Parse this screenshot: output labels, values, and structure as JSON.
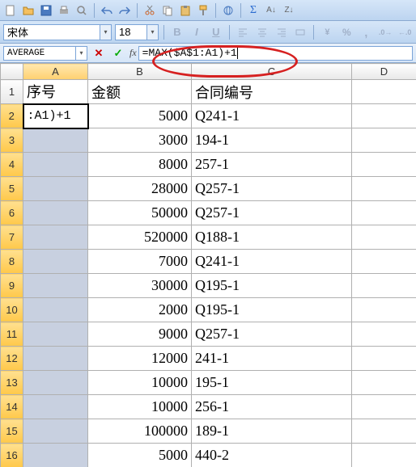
{
  "toolbar": {
    "icons_row1": [
      "new",
      "open",
      "save",
      "print",
      "preview",
      "sep",
      "undo",
      "redo",
      "sep",
      "cut",
      "copy",
      "paste",
      "format-painter",
      "sep",
      "hyperlink",
      "sep",
      "sum",
      "sort-asc",
      "sort-desc"
    ]
  },
  "font": {
    "name": "宋体",
    "size": "18"
  },
  "format_buttons": [
    "B",
    "I",
    "U",
    "sep",
    "align-left-icon",
    "align-center-icon",
    "align-right-icon",
    "merge-icon",
    "sep",
    "currency-icon",
    "percent-icon",
    "comma-icon",
    "decimal-inc-icon",
    "decimal-dec-icon"
  ],
  "name_box": "AVERAGE",
  "formula": "=MAX($A$1:A1)+1",
  "columns": [
    "A",
    "B",
    "C",
    "D"
  ],
  "headers": {
    "A": "序号",
    "B": "金额",
    "C": "合同编号"
  },
  "active_display": ":A1)+1",
  "rows": [
    {
      "n": 1,
      "header": true
    },
    {
      "n": 2,
      "B": "5000",
      "C": "Q241-1",
      "active": true
    },
    {
      "n": 3,
      "B": "3000",
      "C": "194-1"
    },
    {
      "n": 4,
      "B": "8000",
      "C": "257-1"
    },
    {
      "n": 5,
      "B": "28000",
      "C": "Q257-1"
    },
    {
      "n": 6,
      "B": "50000",
      "C": "Q257-1"
    },
    {
      "n": 7,
      "B": "520000",
      "C": "Q188-1"
    },
    {
      "n": 8,
      "B": "7000",
      "C": "Q241-1"
    },
    {
      "n": 9,
      "B": "30000",
      "C": "Q195-1"
    },
    {
      "n": 10,
      "B": "2000",
      "C": "Q195-1"
    },
    {
      "n": 11,
      "B": "9000",
      "C": "Q257-1"
    },
    {
      "n": 12,
      "B": "12000",
      "C": "241-1"
    },
    {
      "n": 13,
      "B": "10000",
      "C": "195-1"
    },
    {
      "n": 14,
      "B": "10000",
      "C": "256-1"
    },
    {
      "n": 15,
      "B": "100000",
      "C": "189-1"
    },
    {
      "n": 16,
      "B": "5000",
      "C": "440-2"
    }
  ]
}
